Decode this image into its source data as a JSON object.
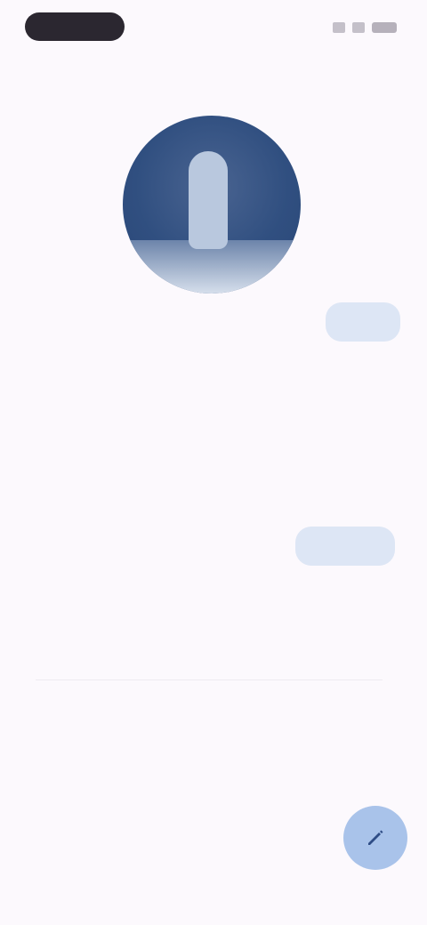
{
  "status": {
    "time": "",
    "icons": [
      "signal-icon",
      "wifi-icon",
      "battery-icon"
    ]
  },
  "nav": {
    "back_label": ""
  },
  "profile": {
    "caption": ""
  },
  "chat": {
    "bubble_1": "",
    "message_1": "",
    "message_2": "",
    "bubble_2": "",
    "message_3": ""
  },
  "footer": {
    "meta": [
      "",
      "",
      ""
    ],
    "action": ""
  },
  "fab": {
    "icon": "compose-icon"
  },
  "colors": {
    "background": "#fcf9fd",
    "accent": "#7f9fdc",
    "fab": "#a9c3ea",
    "avatar": "#304f80"
  }
}
